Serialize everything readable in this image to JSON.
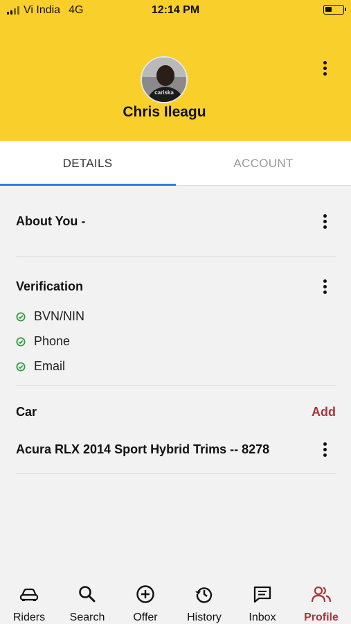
{
  "status_bar": {
    "carrier": "Vi India",
    "network": "4G",
    "time": "12:14 PM"
  },
  "profile": {
    "name": "Chris Ileagu",
    "avatar_caption": "cariska"
  },
  "tabs": [
    {
      "label": "DETAILS",
      "active": true
    },
    {
      "label": "ACCOUNT",
      "active": false
    }
  ],
  "about": {
    "title": "About You -"
  },
  "verification": {
    "title": "Verification",
    "items": [
      {
        "label": "BVN/NIN",
        "verified": true
      },
      {
        "label": "Phone",
        "verified": true
      },
      {
        "label": "Email",
        "verified": true
      }
    ]
  },
  "car": {
    "title": "Car",
    "add_label": "Add",
    "items": [
      {
        "label": "Acura RLX  2014 Sport Hybrid Trims -- 8278"
      }
    ]
  },
  "bottom_nav": [
    {
      "label": "Riders",
      "icon": "car-icon",
      "active": false
    },
    {
      "label": "Search",
      "icon": "search-icon",
      "active": false
    },
    {
      "label": "Offer",
      "icon": "plus-circle-icon",
      "active": false
    },
    {
      "label": "History",
      "icon": "history-icon",
      "active": false
    },
    {
      "label": "Inbox",
      "icon": "message-icon",
      "active": false
    },
    {
      "label": "Profile",
      "icon": "users-icon",
      "active": true
    }
  ],
  "colors": {
    "header": "#f9cf2b",
    "accent": "#a8353b",
    "tab_indicator": "#2f7fd6",
    "check": "#2e9e3e"
  }
}
